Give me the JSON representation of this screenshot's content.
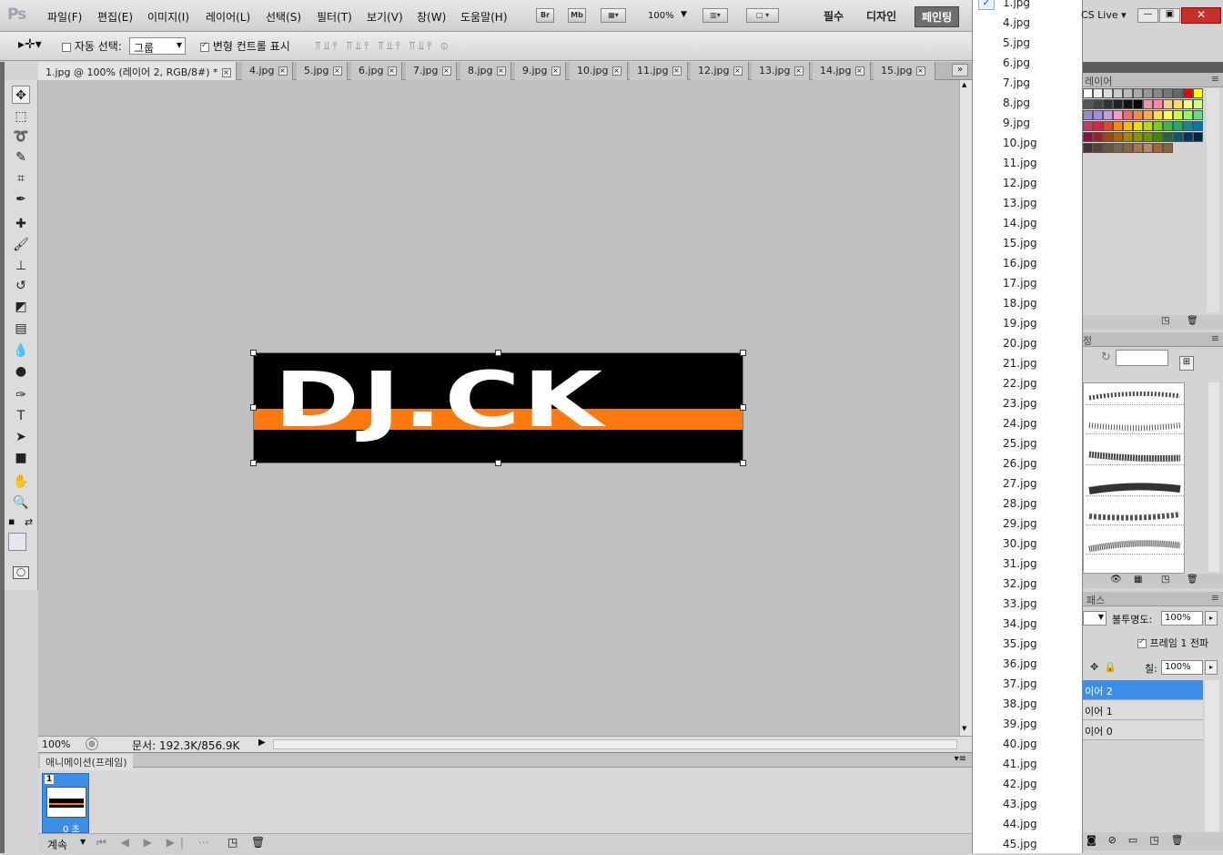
{
  "app": {
    "logo": "Ps"
  },
  "menu": [
    "파일(F)",
    "편집(E)",
    "이미지(I)",
    "레이어(L)",
    "선택(S)",
    "필터(T)",
    "보기(V)",
    "창(W)",
    "도움말(H)"
  ],
  "menubar_tools": {
    "bridge": "Br",
    "minibridge": "Mb",
    "zoom": "100%"
  },
  "workspaces": {
    "essentials": "필수",
    "design": "디자인",
    "painting": "페인팅"
  },
  "cs_live": "CS Live",
  "options": {
    "auto_select_label": "자동 선택:",
    "auto_select_value": "그룹",
    "transform_label": "변형 컨트롤 표시"
  },
  "tabs": [
    {
      "label": "1.jpg @ 100% (레이어 2, RGB/8#) *"
    },
    {
      "label": "4.jpg"
    },
    {
      "label": "5.jpg"
    },
    {
      "label": "6.jpg"
    },
    {
      "label": "7.jpg"
    },
    {
      "label": "8.jpg"
    },
    {
      "label": "9.jpg"
    },
    {
      "label": "10.jpg"
    },
    {
      "label": "11.jpg"
    },
    {
      "label": "12.jpg"
    },
    {
      "label": "13.jpg"
    },
    {
      "label": "14.jpg"
    },
    {
      "label": "15.jpg"
    }
  ],
  "artwork": {
    "text": "DJ.CK",
    "colors": {
      "background": "#000000",
      "stripe": "#ff7a0e",
      "text": "#ffffff"
    }
  },
  "status": {
    "zoom": "100%",
    "doc": "문서: 192.3K/856.9K"
  },
  "animation": {
    "tab": "애니메이션(프레임)",
    "frame_number": "1",
    "frame_delay": "0 초",
    "loop": "계속"
  },
  "window_menu": [
    "1.jpg",
    "4.jpg",
    "5.jpg",
    "6.jpg",
    "7.jpg",
    "8.jpg",
    "9.jpg",
    "10.jpg",
    "11.jpg",
    "12.jpg",
    "13.jpg",
    "14.jpg",
    "15.jpg",
    "16.jpg",
    "17.jpg",
    "18.jpg",
    "19.jpg",
    "20.jpg",
    "21.jpg",
    "22.jpg",
    "23.jpg",
    "24.jpg",
    "25.jpg",
    "26.jpg",
    "27.jpg",
    "28.jpg",
    "29.jpg",
    "30.jpg",
    "31.jpg",
    "32.jpg",
    "33.jpg",
    "34.jpg",
    "35.jpg",
    "36.jpg",
    "37.jpg",
    "38.jpg",
    "39.jpg",
    "40.jpg",
    "41.jpg",
    "42.jpg",
    "43.jpg",
    "44.jpg",
    "45.jpg"
  ],
  "panels": {
    "swatches_tab": "견본 스타일 조정 레이어",
    "swatches_tab_visible": "레이어",
    "brushes_tab_visible": "정",
    "layers_tab_visible": "패스",
    "opacity_label": "불투명도:",
    "opacity_value": "100%",
    "propagate_label": "프레임 1 전파",
    "fill_label": "칠:",
    "fill_value": "100%",
    "layers": [
      {
        "name": "이어 2",
        "selected": true
      },
      {
        "name": "이어 1",
        "selected": false
      },
      {
        "name": "이어 0",
        "selected": false
      }
    ]
  }
}
